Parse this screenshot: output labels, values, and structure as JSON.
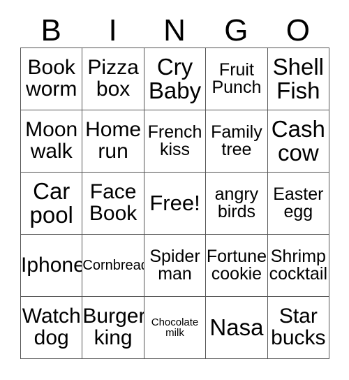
{
  "card": {
    "header": {
      "letters": [
        "B",
        "I",
        "N",
        "G",
        "O"
      ]
    },
    "rows": [
      [
        {
          "text": "Book worm",
          "size": "lg"
        },
        {
          "text": "Pizza box",
          "size": "lg"
        },
        {
          "text": "Cry Baby",
          "size": "xl"
        },
        {
          "text": "Fruit Punch",
          "size": "md"
        },
        {
          "text": "Shell Fish",
          "size": "xl"
        }
      ],
      [
        {
          "text": "Moon walk",
          "size": "lg"
        },
        {
          "text": "Home run",
          "size": "lg"
        },
        {
          "text": "French kiss",
          "size": "md"
        },
        {
          "text": "Family tree",
          "size": "md"
        },
        {
          "text": "Cash cow",
          "size": "xl"
        }
      ],
      [
        {
          "text": "Car pool",
          "size": "xl"
        },
        {
          "text": "Face Book",
          "size": "lg"
        },
        {
          "text": "Free!",
          "size": "free"
        },
        {
          "text": "angry birds",
          "size": "md"
        },
        {
          "text": "Easter egg",
          "size": "md"
        }
      ],
      [
        {
          "text": "Iphone",
          "size": "lg"
        },
        {
          "text": "Cornbread",
          "size": "sm"
        },
        {
          "text": "Spider man",
          "size": "md"
        },
        {
          "text": "Fortune cookie",
          "size": "md"
        },
        {
          "text": "Shrimp cocktail",
          "size": "md"
        }
      ],
      [
        {
          "text": "Watch dog",
          "size": "lg"
        },
        {
          "text": "Burger king",
          "size": "lg"
        },
        {
          "text": "Chocolate milk",
          "size": "xs"
        },
        {
          "text": "Nasa",
          "size": "xl"
        },
        {
          "text": "Star bucks",
          "size": "lg"
        }
      ]
    ],
    "colors": {
      "border": "#555555",
      "text": "#000000",
      "background": "#ffffff"
    }
  }
}
